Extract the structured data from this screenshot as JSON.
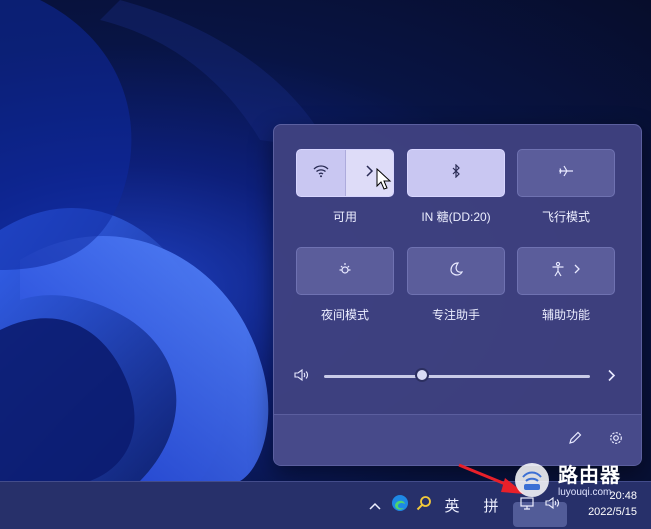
{
  "quick_settings": {
    "tiles": [
      {
        "label": "可用",
        "icon": "wifi-icon",
        "active": true,
        "has_arrow": true
      },
      {
        "label": "IN 糖(DD:20)",
        "icon": "bluetooth-icon",
        "active": true,
        "has_arrow": false
      },
      {
        "label": "飞行模式",
        "icon": "airplane-icon",
        "active": false,
        "has_arrow": false
      },
      {
        "label": "夜间模式",
        "icon": "night-light-icon",
        "active": false,
        "has_arrow": false
      },
      {
        "label": "专注助手",
        "icon": "moon-icon",
        "active": false,
        "has_arrow": false
      },
      {
        "label": "辅助功能",
        "icon": "accessibility-icon",
        "active": false,
        "has_arrow": true
      }
    ],
    "volume": {
      "level": 0.37,
      "icon": "speaker-icon"
    },
    "footer": {
      "edit_icon": "pencil-icon",
      "settings_icon": "gear-icon"
    }
  },
  "taskbar": {
    "ime_lang": "英",
    "ime_mode": "拼",
    "time": "20:48",
    "date": "2022/5/15",
    "icons": [
      "chevron-up-icon",
      "edge-icon",
      "search-icon",
      "network-icon",
      "volume-icon"
    ]
  },
  "watermark": {
    "title": "路由器",
    "url": "luyouqi.com"
  },
  "colors": {
    "panel_bg": "#3f4280",
    "tile_active": "#c9c7f2",
    "taskbar_bg": "#27306a",
    "arrow": "#e8202a"
  }
}
